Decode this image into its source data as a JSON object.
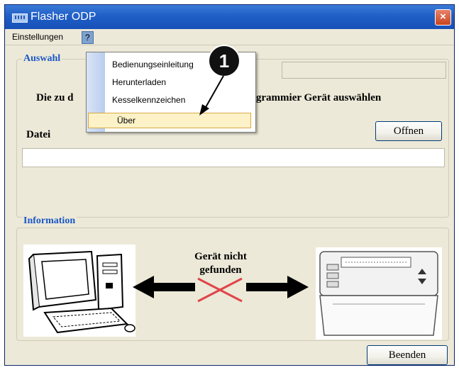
{
  "window": {
    "title": "Flasher ODP",
    "close_glyph": "×"
  },
  "menubar": {
    "items": [
      {
        "label": "Einstellungen"
      },
      {
        "label": "?"
      }
    ]
  },
  "dropdown": {
    "items": [
      {
        "label": "Bedienungseinleitung"
      },
      {
        "label": "Herunterladen"
      },
      {
        "label": "Kesselkennzeichen"
      },
      {
        "label": "Über"
      }
    ]
  },
  "callout": {
    "number": "1"
  },
  "auswahl": {
    "group_title": "Auswahl",
    "instruction_left": "Die zu d",
    "instruction_right": "rogrammier Gerät auswählen",
    "file_label": "Datei",
    "open_button": "Offnen",
    "file_path_value": ""
  },
  "information": {
    "group_title": "Information",
    "status_line1": "Gerät nicht",
    "status_line2": "gefunden"
  },
  "footer": {
    "exit_button": "Beenden"
  },
  "icons": [
    "app-icon",
    "close-icon",
    "computer-icon",
    "arrow-left-icon",
    "arrow-right-icon",
    "cross-icon",
    "device-icon"
  ]
}
